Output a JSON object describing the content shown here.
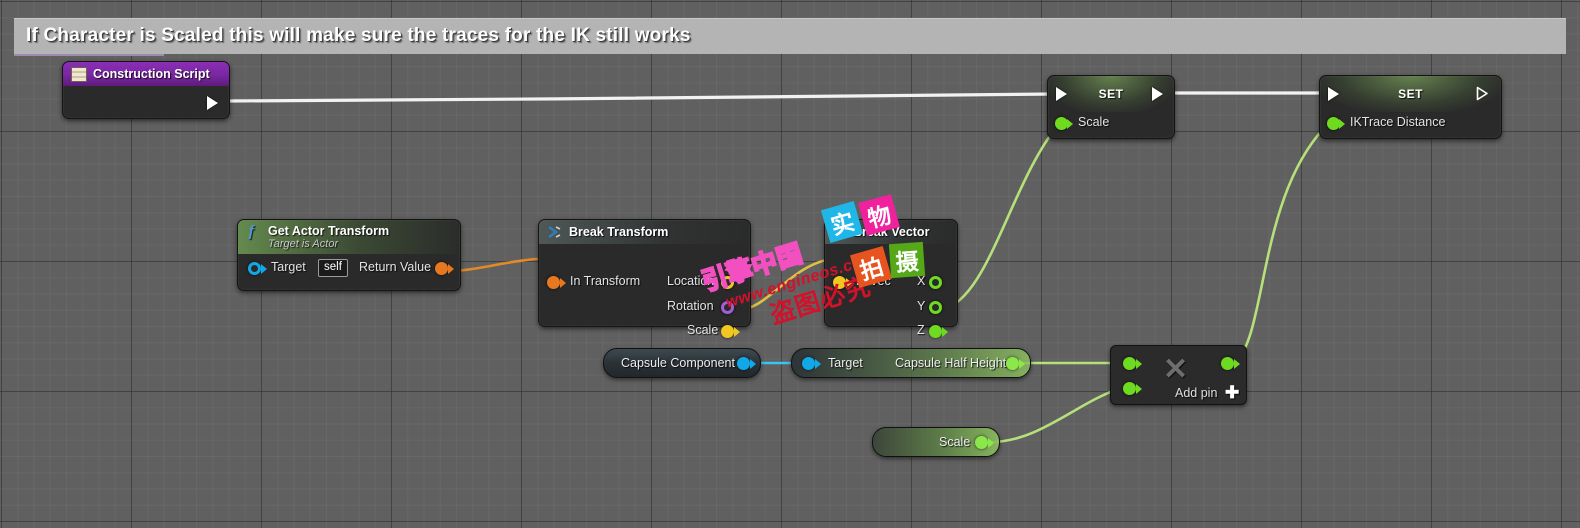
{
  "graph": {
    "comment": {
      "title": "If Character is Scaled this will make sure the traces for the IK still works"
    }
  },
  "nodes": {
    "construction_script": {
      "title": "Construction Script",
      "icon": "construction-script-icon",
      "exec_out": "exec-out-pin"
    },
    "set_scale": {
      "title": "SET",
      "exec_in": "exec-in-pin",
      "exec_out": "exec-out-pin",
      "input_label": "Scale"
    },
    "set_iktrace": {
      "title": "SET",
      "exec_in": "exec-in-pin",
      "exec_out": "exec-out-pin",
      "input_label": "IKTrace Distance"
    },
    "get_actor_transform": {
      "title": "Get Actor Transform",
      "subtitle": "Target is Actor",
      "icon": "function-f-icon",
      "target_label": "Target",
      "target_value": "self",
      "return_label": "Return Value"
    },
    "break_transform": {
      "title": "Break Transform",
      "icon": "break-struct-icon",
      "input_label": "In Transform",
      "outputs": [
        "Location",
        "Rotation",
        "Scale"
      ]
    },
    "break_vector": {
      "title": "Break Vector",
      "icon": "break-struct-icon",
      "input_label": "In Vec",
      "outputs": [
        "X",
        "Y",
        "Z"
      ]
    },
    "capsule_component": {
      "title": "Capsule Component"
    },
    "get_capsule_half_height": {
      "target_label": "Target",
      "return_label": "Capsule Half Height"
    },
    "multiply": {
      "operator": "✕",
      "add_pin_label": "Add pin",
      "add_pin_plus": "✚"
    },
    "scale_getter": {
      "title": "Scale"
    }
  },
  "colors": {
    "exec_wire": "#f2f2f2",
    "float_wire": "#a6e05a",
    "struct_wire": "#e08a2a",
    "vector_wire": "#e0c040",
    "object_wire": "#22b0f0",
    "exec_pin": "#ffffff",
    "float_pin": "#6fdb20",
    "struct_pin": "#e87820",
    "vector_pin": "#f0c820",
    "object_pin": "#12a8e8",
    "header_purple": "#8b2fb5"
  },
  "watermarks": {
    "cn_brand": "引擎中国",
    "url": "www.engineos.com",
    "cn_warn": "盗图必究",
    "blocks": [
      "实",
      "物",
      "拍",
      "摄"
    ]
  }
}
